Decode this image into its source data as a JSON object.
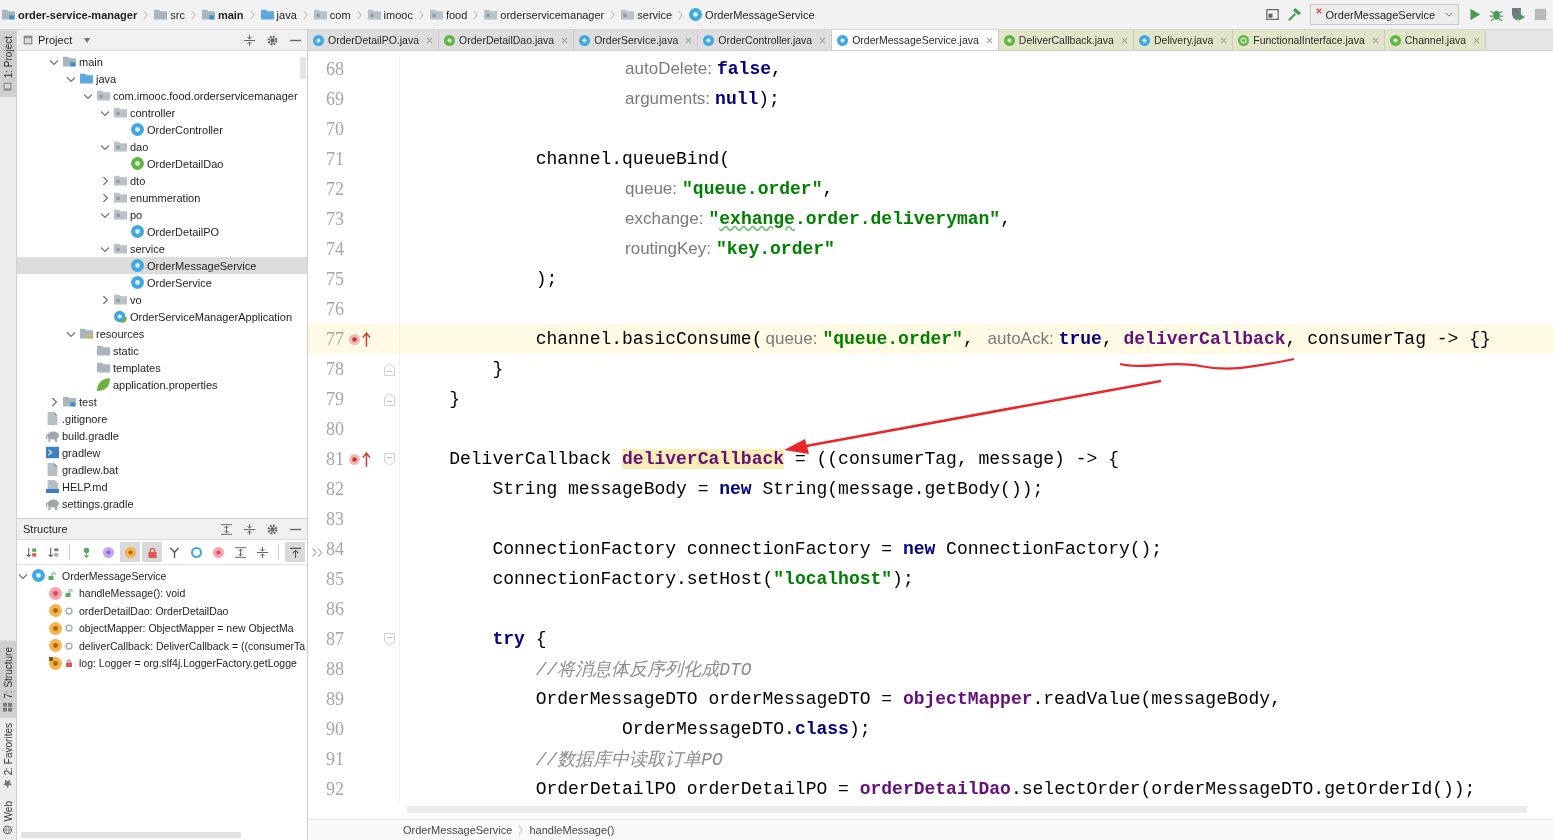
{
  "navigation": {
    "path": [
      {
        "label": "order-service-manager",
        "kind": "module"
      },
      {
        "label": "src",
        "kind": "folder"
      },
      {
        "label": "main",
        "kind": "module"
      },
      {
        "label": "java",
        "kind": "source_folder"
      },
      {
        "label": "com",
        "kind": "package"
      },
      {
        "label": "imooc",
        "kind": "package"
      },
      {
        "label": "food",
        "kind": "package"
      },
      {
        "label": "orderservicemanager",
        "kind": "package"
      },
      {
        "label": "service",
        "kind": "package"
      },
      {
        "label": "OrderMessageService",
        "kind": "class"
      }
    ],
    "run_config": {
      "label": "OrderMessageService"
    }
  },
  "tool_strip": {
    "top": [
      {
        "label": "1: Project",
        "kind": "project",
        "active": true
      }
    ],
    "bottom": [
      {
        "label": "7: Structure",
        "kind": "structure",
        "active": true
      },
      {
        "label": "2: Favorites",
        "kind": "favorites",
        "active": false
      },
      {
        "label": "Web",
        "kind": "web",
        "active": false
      }
    ]
  },
  "project": {
    "title": "Project",
    "tree": [
      {
        "children": [
          {
            "label": "main",
            "kind": "module",
            "expanded": true,
            "selected": false,
            "children": [
              {
                "label": "java",
                "kind": "source_folder",
                "expanded": true,
                "selected": false,
                "children": [
                  {
                    "label": "com.imooc.food.orderservicemanager",
                    "kind": "package",
                    "expanded": true,
                    "selected": false,
                    "children": [
                      {
                        "label": "controller",
                        "kind": "package",
                        "expanded": true,
                        "selected": false,
                        "children": [
                          {
                            "label": "OrderController",
                            "kind": "class",
                            "selected": false
                          }
                        ]
                      },
                      {
                        "label": "dao",
                        "kind": "package",
                        "expanded": true,
                        "selected": false,
                        "children": [
                          {
                            "label": "OrderDetailDao",
                            "kind": "interface",
                            "selected": false
                          }
                        ]
                      },
                      {
                        "label": "dto",
                        "kind": "package",
                        "expanded": false,
                        "selected": false
                      },
                      {
                        "label": "enummeration",
                        "kind": "package",
                        "expanded": false,
                        "selected": false
                      },
                      {
                        "label": "po",
                        "kind": "package",
                        "expanded": true,
                        "selected": false,
                        "children": [
                          {
                            "label": "OrderDetailPO",
                            "kind": "class",
                            "selected": false
                          }
                        ]
                      },
                      {
                        "label": "service",
                        "kind": "package",
                        "expanded": true,
                        "selected": false,
                        "children": [
                          {
                            "label": "OrderMessageService",
                            "kind": "class",
                            "selected": true
                          },
                          {
                            "label": "OrderService",
                            "kind": "class",
                            "selected": false
                          }
                        ]
                      },
                      {
                        "label": "vo",
                        "kind": "package",
                        "expanded": false,
                        "selected": false
                      },
                      {
                        "label": "OrderServiceManagerApplication",
                        "kind": "spring_class",
                        "selected": false
                      }
                    ]
                  }
                ]
              },
              {
                "label": "resources",
                "kind": "resource_folder",
                "expanded": true,
                "selected": false,
                "children": [
                  {
                    "label": "static",
                    "kind": "folder",
                    "selected": false
                  },
                  {
                    "label": "templates",
                    "kind": "folder",
                    "selected": false
                  },
                  {
                    "label": "application.properties",
                    "kind": "spring_config",
                    "selected": false
                  }
                ]
              }
            ]
          },
          {
            "label": "test",
            "kind": "module",
            "expanded": false,
            "selected": false
          }
        ]
      },
      {
        "label": ".gitignore",
        "kind": "text_file",
        "selected": false
      },
      {
        "label": "build.gradle",
        "kind": "gradle",
        "selected": false
      },
      {
        "label": "gradlew",
        "kind": "shell",
        "selected": false
      },
      {
        "label": "gradlew.bat",
        "kind": "text_file",
        "selected": false
      },
      {
        "label": "HELP.md",
        "kind": "markdown",
        "selected": false
      },
      {
        "label": "settings.gradle",
        "kind": "gradle",
        "selected": false
      }
    ]
  },
  "structure": {
    "title": "Structure",
    "toolbar": [
      {
        "kind": "sort_visibility",
        "on": false
      },
      {
        "kind": "sort_alpha",
        "on": false
      },
      {
        "kind": "separator"
      },
      {
        "kind": "inherited",
        "on": false
      },
      {
        "kind": "properties",
        "on": false
      },
      {
        "kind": "fields",
        "on": true
      },
      {
        "kind": "non_public",
        "on": true
      },
      {
        "kind": "interfaces",
        "on": false
      },
      {
        "kind": "anonymous",
        "on": false
      },
      {
        "kind": "lambdas",
        "on": false
      },
      {
        "kind": "expand",
        "on": false
      },
      {
        "kind": "collapse",
        "on": false
      },
      {
        "kind": "separator"
      },
      {
        "kind": "autoscroll",
        "on": true
      },
      {
        "kind": "more",
        "on": false
      }
    ],
    "tree": [
      {
        "label": "OrderMessageService",
        "kind": "class",
        "access": {
          "kind": "public"
        },
        "expanded": true,
        "selected": false,
        "children": [
          {
            "label": "handleMessage(): void",
            "kind": "method",
            "access": {
              "kind": "public"
            },
            "selected": false
          },
          {
            "label": "orderDetailDao: OrderDetailDao",
            "kind": "field",
            "access": {
              "kind": "package_private"
            },
            "selected": false
          },
          {
            "label": "objectMapper: ObjectMapper = new ObjectMa",
            "kind": "field",
            "access": {
              "kind": "package_private"
            },
            "selected": false
          },
          {
            "label": "deliverCallback: DeliverCallback = ((consumerTa",
            "kind": "field",
            "access": {
              "kind": "package_private"
            },
            "selected": false
          },
          {
            "label": "log: Logger = org.slf4j.LoggerFactory.getLogge",
            "kind": "static_field",
            "access": {
              "kind": "private"
            },
            "selected": false
          }
        ]
      }
    ]
  },
  "tabs": [
    {
      "label": "OrderDetailPO.java",
      "kind": "class",
      "library": false,
      "selected": false
    },
    {
      "label": "OrderDetailDao.java",
      "kind": "interface",
      "library": false,
      "selected": false
    },
    {
      "label": "OrderService.java",
      "kind": "class",
      "library": false,
      "selected": false
    },
    {
      "label": "OrderController.java",
      "kind": "class",
      "library": false,
      "selected": false
    },
    {
      "label": "OrderMessageService.java",
      "kind": "class",
      "library": false,
      "selected": true
    },
    {
      "label": "DeliverCallback.java",
      "kind": "interface",
      "library": true,
      "selected": false
    },
    {
      "label": "Delivery.java",
      "kind": "class",
      "library": true,
      "selected": false
    },
    {
      "label": "FunctionalInterface.java",
      "kind": "annotation",
      "library": true,
      "selected": false
    },
    {
      "label": "Channel.java",
      "kind": "interface",
      "library": true,
      "selected": false
    }
  ],
  "editor": {
    "lines": [
      {
        "number": "68",
        "current": false,
        "tokens": [
          {
            "kind": "hint",
            "text": "                    autoDelete:"
          },
          {
            "kind": "keyword",
            "text": "false"
          },
          {
            "kind": "plain",
            "text": ","
          }
        ]
      },
      {
        "number": "69",
        "current": false,
        "tokens": [
          {
            "kind": "hint",
            "text": "                    arguments:"
          },
          {
            "kind": "keyword",
            "text": "null"
          },
          {
            "kind": "plain",
            "text": ");"
          }
        ]
      },
      {
        "number": "70",
        "current": false
      },
      {
        "number": "71",
        "current": false,
        "tokens": [
          {
            "kind": "plain",
            "text": "            channel.queueBind("
          }
        ]
      },
      {
        "number": "72",
        "current": false,
        "tokens": [
          {
            "kind": "hint",
            "text": "                    queue:"
          },
          {
            "kind": "string",
            "text": "\"queue.order\""
          },
          {
            "kind": "plain",
            "text": ","
          }
        ]
      },
      {
        "number": "73",
        "current": false,
        "tokens": [
          {
            "kind": "hint",
            "text": "                    exchange:"
          },
          {
            "kind": "string",
            "text": "\""
          },
          {
            "kind": "typo",
            "text": "exhange"
          },
          {
            "kind": "string",
            "text": ".order.deliveryman\""
          },
          {
            "kind": "plain",
            "text": ","
          }
        ]
      },
      {
        "number": "74",
        "current": false,
        "tokens": [
          {
            "kind": "hint",
            "text": "                    routingKey:"
          },
          {
            "kind": "string",
            "text": "\"key.order\""
          }
        ]
      },
      {
        "number": "75",
        "current": false,
        "tokens": [
          {
            "kind": "plain",
            "text": "            );"
          }
        ]
      },
      {
        "number": "76",
        "current": false
      },
      {
        "number": "77",
        "current": true,
        "gutter": [
          {
            "kind": "lambda"
          }
        ],
        "tokens": [
          {
            "kind": "plain",
            "text": "            channel.basicConsume("
          },
          {
            "kind": "hint",
            "text": "queue:"
          },
          {
            "kind": "string",
            "text": "\"queue.order\""
          },
          {
            "kind": "plain",
            "text": ", "
          },
          {
            "kind": "hint",
            "text": "autoAck:"
          },
          {
            "kind": "keyword",
            "text": "true"
          },
          {
            "kind": "plain",
            "text": ", "
          },
          {
            "kind": "field",
            "text": "deliverCallback"
          },
          {
            "kind": "plain",
            "text": ", consumerTag -> {}"
          }
        ]
      },
      {
        "number": "78",
        "current": false,
        "gutter": [
          {
            "kind": "fold_end"
          }
        ],
        "tokens": [
          {
            "kind": "plain",
            "text": "        }"
          }
        ]
      },
      {
        "number": "79",
        "current": false,
        "gutter": [
          {
            "kind": "fold_end"
          }
        ],
        "tokens": [
          {
            "kind": "plain",
            "text": "    }"
          }
        ]
      },
      {
        "number": "80",
        "current": false
      },
      {
        "number": "81",
        "current": false,
        "gutter": [
          {
            "kind": "lambda"
          },
          {
            "kind": "fold_start"
          }
        ],
        "tokens": [
          {
            "kind": "plain",
            "text": "    DeliverCallback "
          },
          {
            "kind": "match",
            "text": "deliverCallback"
          },
          {
            "kind": "plain",
            "text": " = ((consumerTag, message) -> {"
          }
        ]
      },
      {
        "number": "82",
        "current": false,
        "tokens": [
          {
            "kind": "plain",
            "text": "        String messageBody = "
          },
          {
            "kind": "keyword",
            "text": "new"
          },
          {
            "kind": "plain",
            "text": " String(message.getBody());"
          }
        ]
      },
      {
        "number": "83",
        "current": false
      },
      {
        "number": "84",
        "current": false,
        "tokens": [
          {
            "kind": "plain",
            "text": "        ConnectionFactory connectionFactory = "
          },
          {
            "kind": "keyword",
            "text": "new"
          },
          {
            "kind": "plain",
            "text": " ConnectionFactory();"
          }
        ]
      },
      {
        "number": "85",
        "current": false,
        "tokens": [
          {
            "kind": "plain",
            "text": "        connectionFactory.setHost("
          },
          {
            "kind": "string",
            "text": "\"localhost\""
          },
          {
            "kind": "plain",
            "text": ");"
          }
        ]
      },
      {
        "number": "86",
        "current": false
      },
      {
        "number": "87",
        "current": false,
        "gutter": [
          {
            "kind": "fold_start"
          }
        ],
        "tokens": [
          {
            "kind": "keyword",
            "text": "        try"
          },
          {
            "kind": "plain",
            "text": " {"
          }
        ]
      },
      {
        "number": "88",
        "current": false,
        "tokens": [
          {
            "kind": "comment",
            "text": "            //将消息体反序列化成DTO"
          }
        ]
      },
      {
        "number": "89",
        "current": false,
        "tokens": [
          {
            "kind": "plain",
            "text": "            OrderMessageDTO orderMessageDTO = "
          },
          {
            "kind": "field",
            "text": "objectMapper"
          },
          {
            "kind": "plain",
            "text": ".readValue(messageBody,"
          }
        ]
      },
      {
        "number": "90",
        "current": false,
        "tokens": [
          {
            "kind": "plain",
            "text": "                    OrderMessageDTO."
          },
          {
            "kind": "keyword",
            "text": "class"
          },
          {
            "kind": "plain",
            "text": ");"
          }
        ]
      },
      {
        "number": "91",
        "current": false,
        "tokens": [
          {
            "kind": "comment",
            "text": "            //数据库中读取订单PO"
          }
        ]
      },
      {
        "number": "92",
        "current": false,
        "tokens": [
          {
            "kind": "plain",
            "text": "            OrderDetailPO orderDetailPO = "
          },
          {
            "kind": "field",
            "text": "orderDetailDao"
          },
          {
            "kind": "plain",
            "text": ".selectOrder(orderMessageDTO.getOrderId());"
          }
        ]
      }
    ],
    "breadcrumb": [
      "OrderMessageService",
      "handleMessage()"
    ]
  }
}
